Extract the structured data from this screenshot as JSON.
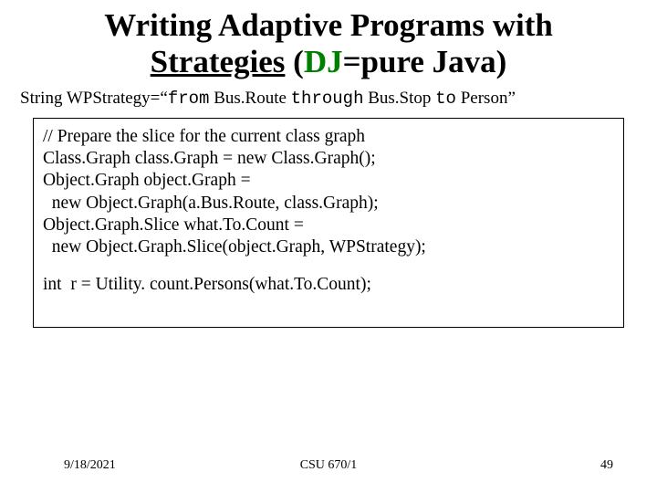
{
  "title": {
    "line1_pre": "Writing Adaptive Programs with",
    "line2_strategies": "Strategies",
    "line2_paren_open": " (",
    "line2_dj": "DJ",
    "line2_tail": "=pure Java)"
  },
  "strategy": {
    "lhs": "String WPStrategy=",
    "q_open": "“",
    "kw_from": "from",
    "busroute": " Bus.Route ",
    "kw_through": "through",
    "busstop_to_person": " Bus.Stop ",
    "kw_to": "to",
    "person": " Person",
    "q_close": "”"
  },
  "code": {
    "c1": "// Prepare the slice for the current class graph",
    "c2": "Class.Graph class.Graph = new Class.Graph();",
    "c3": "Object.Graph object.Graph =",
    "c4": "  new Object.Graph(a.Bus.Route, class.Graph);",
    "c5": "Object.Graph.Slice what.To.Count =",
    "c6": "  new Object.Graph.Slice(object.Graph, WPStrategy);",
    "c7": "int  r = Utility. count.Persons(what.To.Count);"
  },
  "footer": {
    "date": "9/18/2021",
    "course": "CSU 670/1",
    "page": "49"
  }
}
